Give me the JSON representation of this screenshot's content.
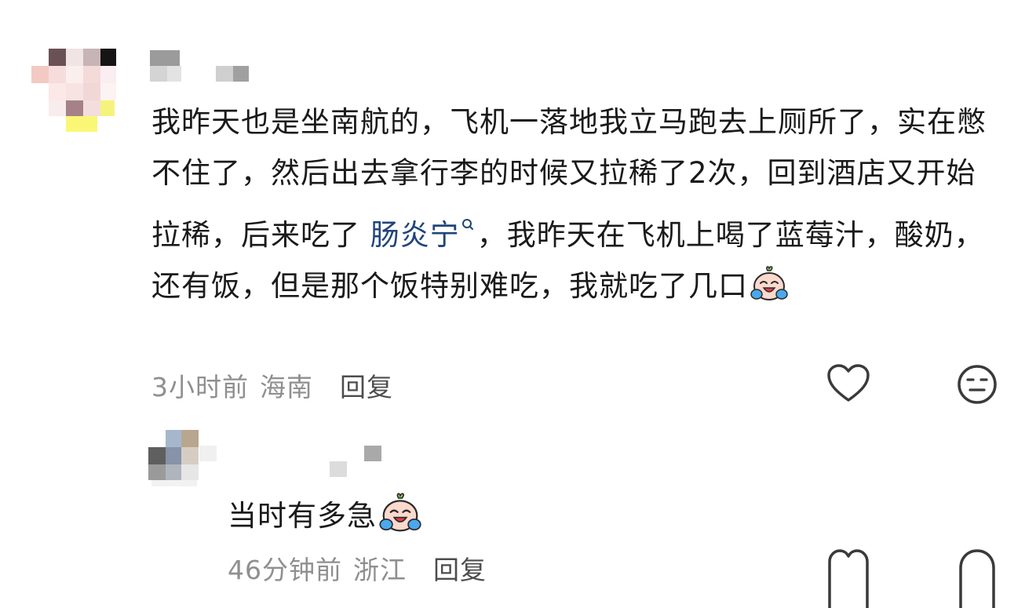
{
  "comment": {
    "avatar_alt": "blurred-avatar",
    "text_before_link": "我昨天也是坐南航的，飞机一落地我立马跑去上厕所了，实在憋不住了，然后出去拿行李的时候又拉稀了2次，回到酒店又开始拉稀，后来吃了 ",
    "link_text": "肠炎宁",
    "text_after_link": "，我昨天在飞机上喝了蓝莓汁，酸奶，还有饭，但是那个饭特别难吃，我就吃了几口",
    "emoji": "crying-laughing-emoji",
    "time": "3小时前",
    "location": "海南",
    "reply_label": "回复"
  },
  "reply": {
    "text": "当时有多急",
    "emoji": "crying-laughing-emoji",
    "time": "46分钟前",
    "location": "浙江",
    "reply_label": "回复"
  },
  "colors": {
    "link": "#20457a",
    "meta": "#8f8f8f",
    "text": "#1a1a1a",
    "icon": "#3a3a3a"
  }
}
